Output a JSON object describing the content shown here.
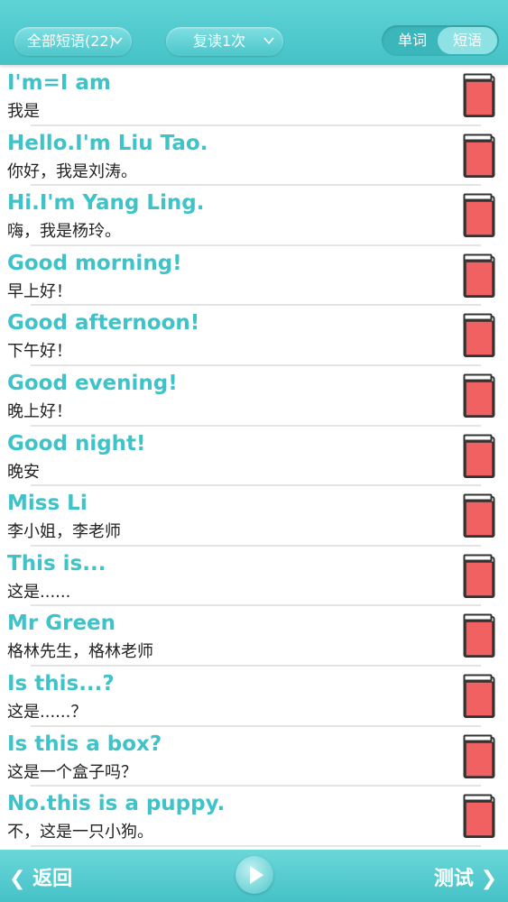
{
  "header": {
    "filter_dropdown": "全部短语(22)",
    "repeat_dropdown": "复读1次",
    "segment": {
      "word": "单词",
      "phrase": "短语",
      "selected": "短语"
    }
  },
  "phrases": [
    {
      "en": "I'm=I am",
      "zh": "我是"
    },
    {
      "en": "Hello.I'm Liu Tao.",
      "zh": "你好，我是刘涛。"
    },
    {
      "en": "Hi.I'm Yang Ling.",
      "zh": "嗨，我是杨玲。"
    },
    {
      "en": "Good morning!",
      "zh": "早上好！"
    },
    {
      "en": "Good afternoon!",
      "zh": "下午好！"
    },
    {
      "en": "Good evening!",
      "zh": "晚上好！"
    },
    {
      "en": "Good night!",
      "zh": "晚安"
    },
    {
      "en": "Miss Li",
      "zh": "李小姐，李老师"
    },
    {
      "en": "This is...",
      "zh": "这是......"
    },
    {
      "en": "Mr Green",
      "zh": "格林先生，格林老师"
    },
    {
      "en": "Is this...?",
      "zh": "这是......？"
    },
    {
      "en": "Is this a box?",
      "zh": "这是一个盒子吗？"
    },
    {
      "en": "No.this is a puppy.",
      "zh": "不，这是一只小狗。"
    }
  ],
  "footer": {
    "back": "返回",
    "test": "测试"
  },
  "colors": {
    "accent": "#45c2c6",
    "phrase_text": "#3fc3c9",
    "book_red": "#f26161"
  }
}
